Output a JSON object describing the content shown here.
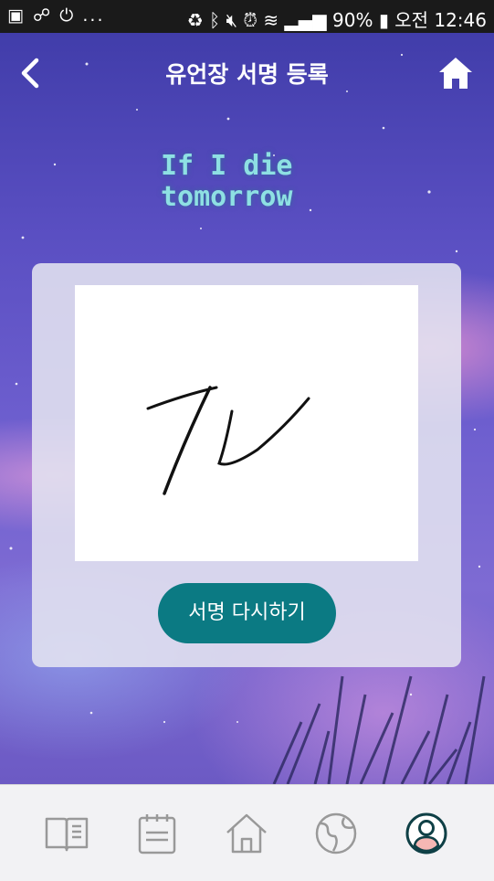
{
  "status_bar": {
    "left_icons": [
      "a-icon",
      "link-icon",
      "power-icon"
    ],
    "left_more": "...",
    "battery": "90%",
    "time": "오전 12:46"
  },
  "header": {
    "title": "유언장 서명 등록",
    "back_icon": "chevron-left-icon",
    "home_icon": "home-icon"
  },
  "logo": {
    "line1": "If I die",
    "line2": "tomorrow"
  },
  "signature": {
    "retry_label": "서명 다시하기"
  },
  "tab_bar": {
    "items": [
      {
        "icon": "book-icon"
      },
      {
        "icon": "notepad-icon"
      },
      {
        "icon": "house-icon"
      },
      {
        "icon": "globe-icon"
      },
      {
        "icon": "profile-icon",
        "active": true
      }
    ]
  },
  "colors": {
    "accent": "#0b7a83",
    "active_tab": "#0f4046",
    "inactive_tab": "#999999"
  }
}
